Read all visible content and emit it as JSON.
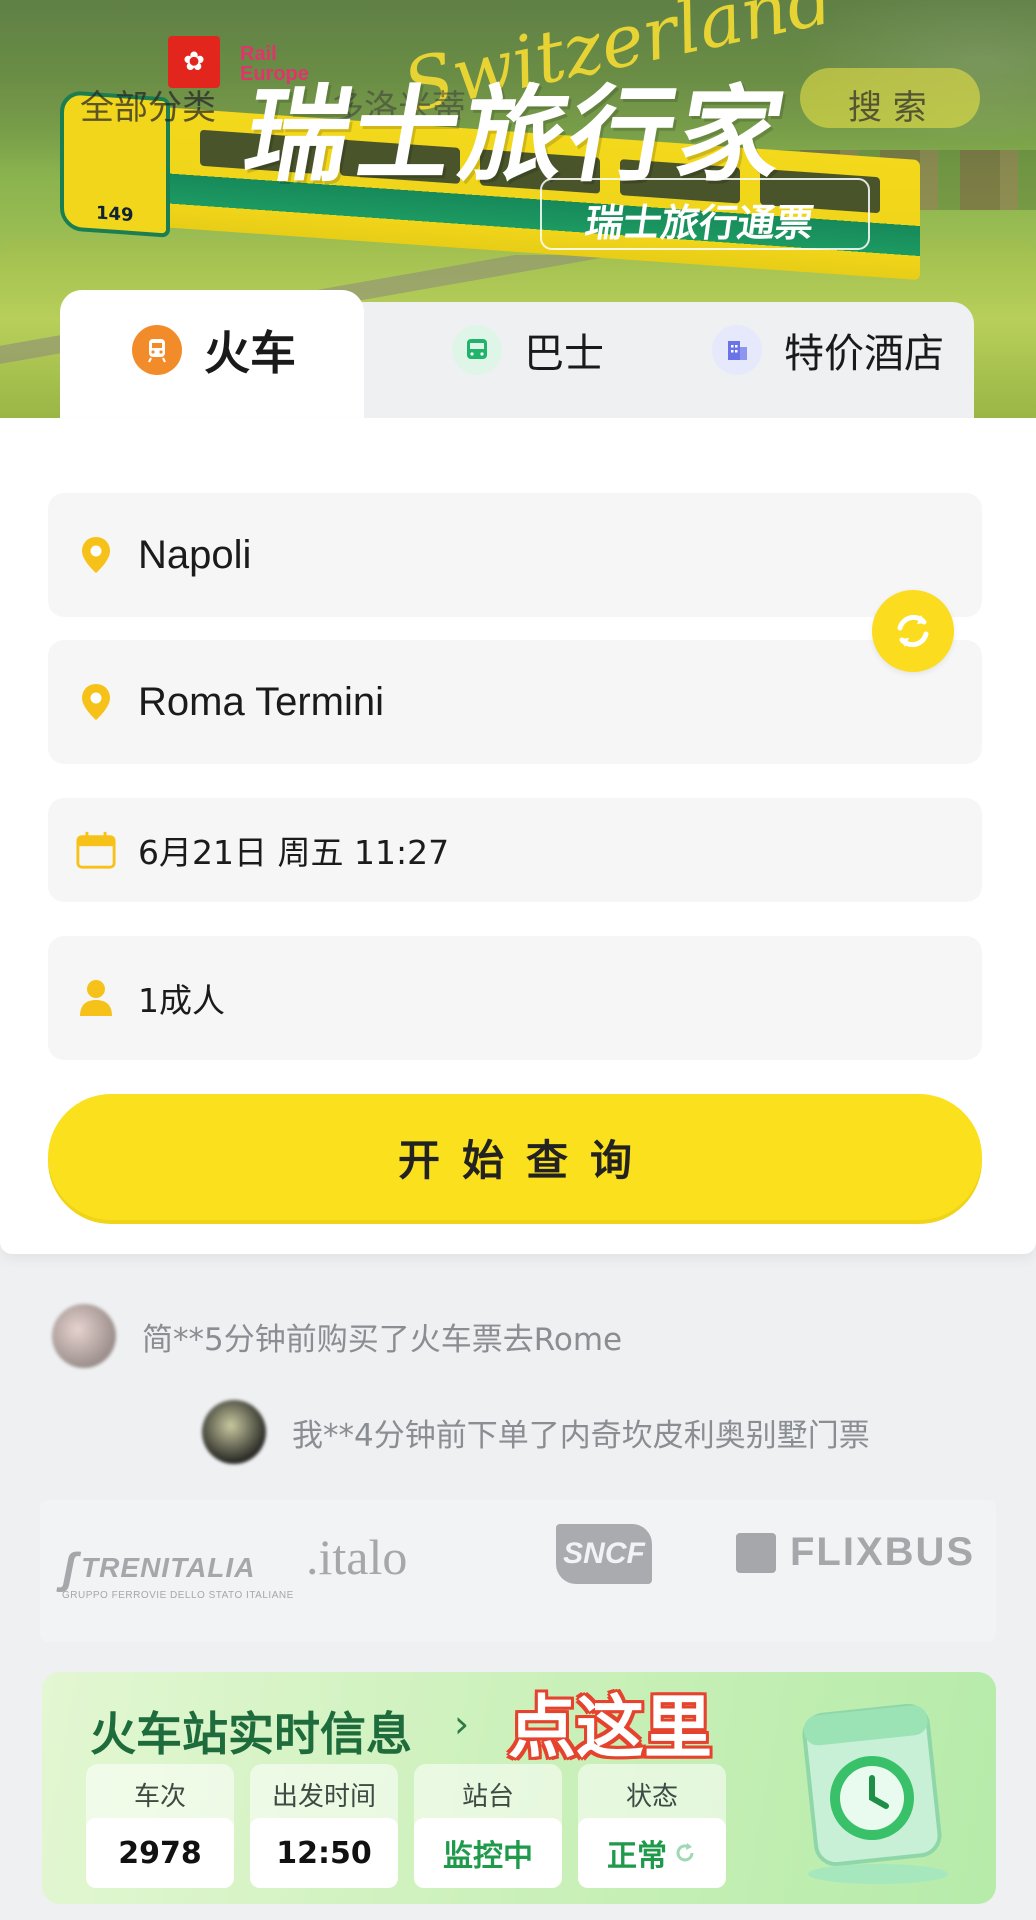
{
  "hero": {
    "category_label": "全部分类",
    "destination_label": "多洛米蒂",
    "search_label": "搜 索",
    "title": "瑞士旅行家",
    "script_text": "Switzerland",
    "pass_label": "瑞士旅行通票",
    "train_number": "149",
    "partner_brand": "Rail Europe"
  },
  "tabs": [
    {
      "label": "火车",
      "icon": "train-icon",
      "active": true
    },
    {
      "label": "巴士",
      "icon": "bus-icon",
      "active": false
    },
    {
      "label": "特价酒店",
      "icon": "hotel-icon",
      "active": false
    }
  ],
  "form": {
    "from": "Napoli",
    "to": "Roma Termini",
    "date": "6月21日 周五 11:27",
    "passengers": "1成人",
    "search_button": "开始查询"
  },
  "feed": [
    {
      "text": "简**5分钟前购买了火车票去Rome"
    },
    {
      "text": "我**4分钟前下单了内奇坎皮利奥别墅门票"
    }
  ],
  "partners": {
    "trenitalia": "TRENITALIA",
    "trenitalia_sub": "GRUPPO FERROVIE DELLO STATO ITALIANE",
    "italo": ".italo",
    "sncf": "SNCF",
    "flixbus": "FLIXBUS"
  },
  "station": {
    "title": "火车站实时信息",
    "chevron": "›",
    "hint": "点这里",
    "columns": [
      {
        "header": "车次",
        "value": "2978"
      },
      {
        "header": "出发时间",
        "value": "12:50"
      },
      {
        "header": "站台",
        "value": "监控中"
      },
      {
        "header": "状态",
        "value": "正常"
      }
    ]
  },
  "colors": {
    "accent_yellow": "#fbe01e",
    "train_orange": "#f28c2a",
    "station_green": "#1e6b3c",
    "hint_red": "#e5432e"
  }
}
